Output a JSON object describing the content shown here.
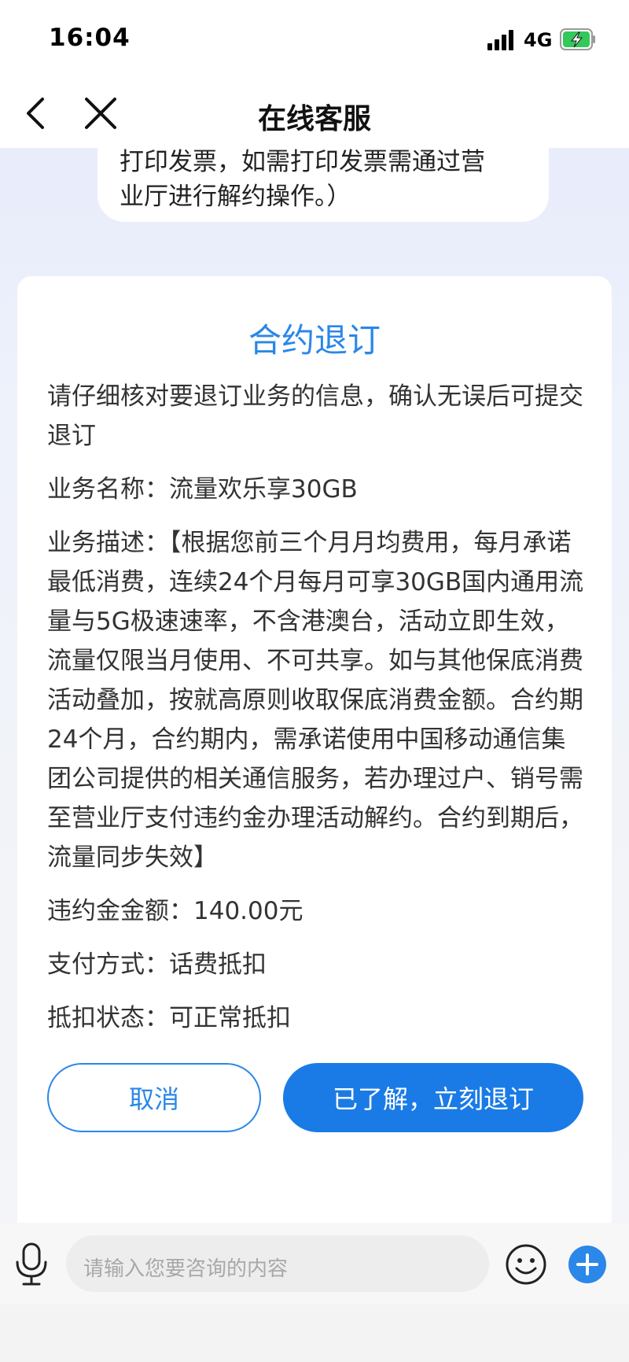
{
  "status_bar": {
    "time": "16:04",
    "network": "4G"
  },
  "nav": {
    "title": "在线客服"
  },
  "previous_message": {
    "line1": "打印发票，如需打印发票需通过营",
    "line2": "业厅进行解约操作。）"
  },
  "card": {
    "title": "合约退订",
    "intro": "请仔细核对要退订业务的信息，确认无误后可提交退订",
    "service_name": "业务名称：流量欢乐享30GB",
    "description": "业务描述：【根据您前三个月月均费用，每月承诺最低消费，连续24个月每月可享30GB国内通用流量与5G极速速率，不含港澳台，活动立即生效，流量仅限当月使用、不可共享。如与其他保底消费活动叠加，按就高原则收取保底消费金额。合约期24个月，合约期内，需承诺使用中国移动通信集团公司提供的相关通信服务，若办理过户、销号需至营业厅支付违约金办理活动解约。合约到期后，流量同步失效】",
    "penalty": "违约金金额：140.00元",
    "payment": "支付方式：话费抵扣",
    "deduct_status": "抵扣状态：可正常抵扣",
    "cancel_label": "取消",
    "confirm_label": "已了解，立刻退订"
  },
  "input": {
    "placeholder": "请输入您要咨询的内容"
  },
  "colors": {
    "accent": "#2b87e8",
    "confirm_bg": "#1a7be6",
    "battery_green": "#34c759"
  }
}
